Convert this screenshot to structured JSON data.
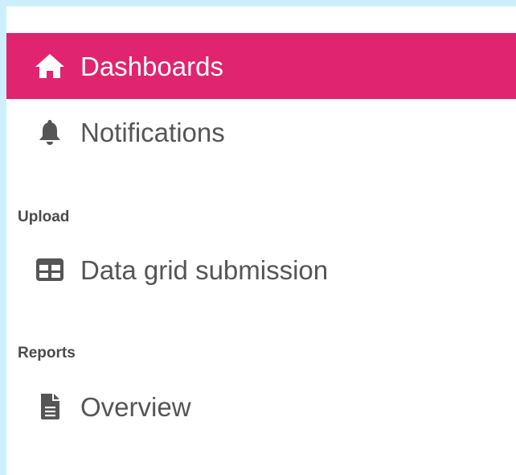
{
  "colors": {
    "background": "#cdeffc",
    "panel": "#ffffff",
    "active_bg": "#e0246f",
    "active_text": "#ffffff",
    "text": "#555555",
    "icon": "#555555"
  },
  "nav": {
    "dashboards": {
      "label": "Dashboards",
      "icon": "home-icon",
      "active": true
    },
    "notifications": {
      "label": "Notifications",
      "icon": "bell-icon",
      "active": false
    }
  },
  "sections": {
    "upload": {
      "heading": "Upload",
      "items": [
        {
          "label": "Data grid submission",
          "icon": "table-icon"
        }
      ]
    },
    "reports": {
      "heading": "Reports",
      "items": [
        {
          "label": "Overview",
          "icon": "file-icon"
        }
      ]
    }
  }
}
